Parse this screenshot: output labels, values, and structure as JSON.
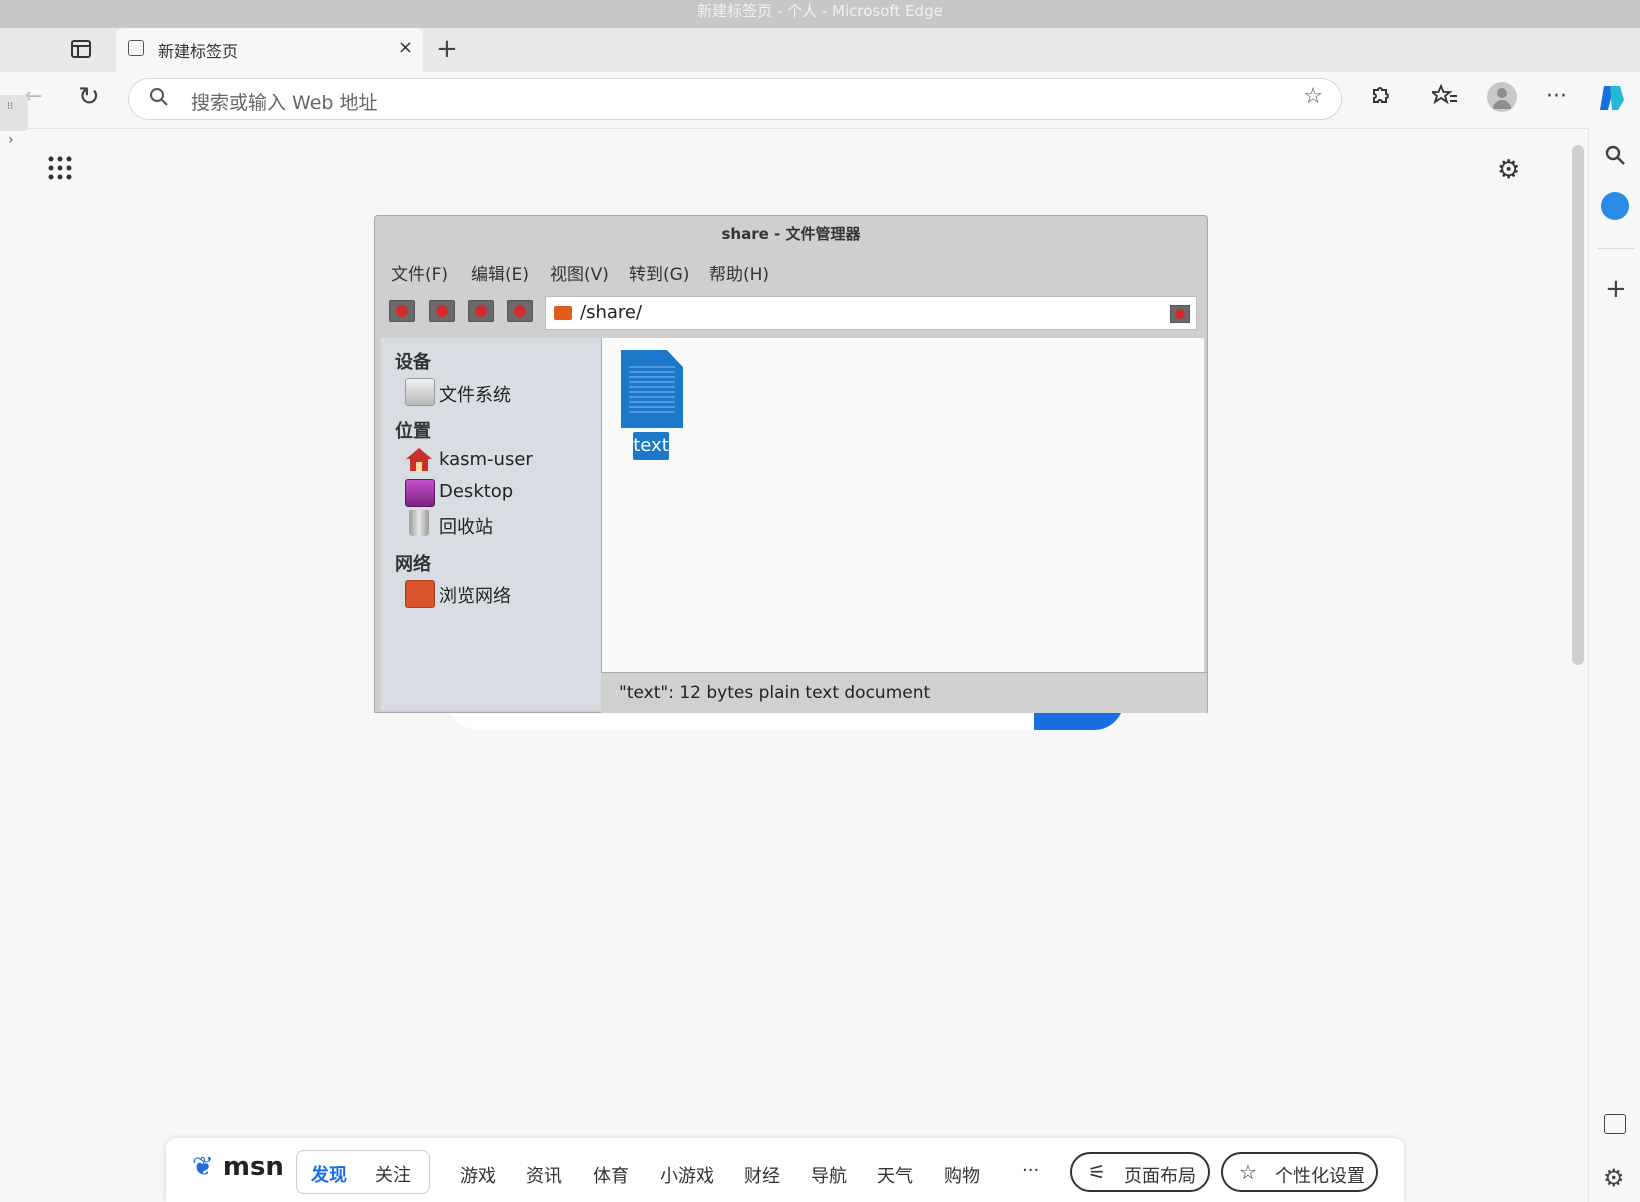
{
  "window": {
    "title": "新建标签页 - 个人 - Microsoft Edge"
  },
  "tabs": [
    {
      "label": "新建标签页",
      "close": "×"
    }
  ],
  "new_tab": "+",
  "address_bar": {
    "placeholder": "搜索或输入 Web 地址"
  },
  "icons": {
    "back": "←",
    "refresh": "↻",
    "search": "🔍",
    "star": "☆",
    "extensions": "⚙",
    "favorites": "☆",
    "more": "···",
    "apps": "⁝⁝⁝",
    "settings": "⚙",
    "plus": "+"
  },
  "file_manager": {
    "title": "share - 文件管理器",
    "menu": [
      "文件(F)",
      "编辑(E)",
      "视图(V)",
      "转到(G)",
      "帮助(H)"
    ],
    "path": "/share/",
    "sidebar": {
      "devices_heading": "设备",
      "devices": [
        {
          "label": "文件系统",
          "icon": "drive-icon"
        }
      ],
      "places_heading": "位置",
      "places": [
        {
          "label": "kasm-user",
          "icon": "home-icon"
        },
        {
          "label": "Desktop",
          "icon": "desktop-icon"
        },
        {
          "label": "回收站",
          "icon": "trash-icon"
        }
      ],
      "network_heading": "网络",
      "network": [
        {
          "label": "浏览网络",
          "icon": "network-icon"
        }
      ]
    },
    "files": [
      {
        "name": "text",
        "type": "text-document",
        "selected": true
      }
    ],
    "status": "\"text\": 12 bytes plain text document"
  },
  "msn": {
    "logo": "msn",
    "feed_tabs": [
      {
        "label": "发现",
        "active": true
      },
      {
        "label": "关注",
        "active": false
      }
    ],
    "nav": [
      "游戏",
      "资讯",
      "体育",
      "小游戏",
      "财经",
      "导航",
      "天气",
      "购物"
    ],
    "more": "···",
    "layout_button": "页面布局",
    "personalize_button": "个性化设置"
  },
  "colors": {
    "accent": "#1a6fe0",
    "selection": "#1c78c8"
  }
}
